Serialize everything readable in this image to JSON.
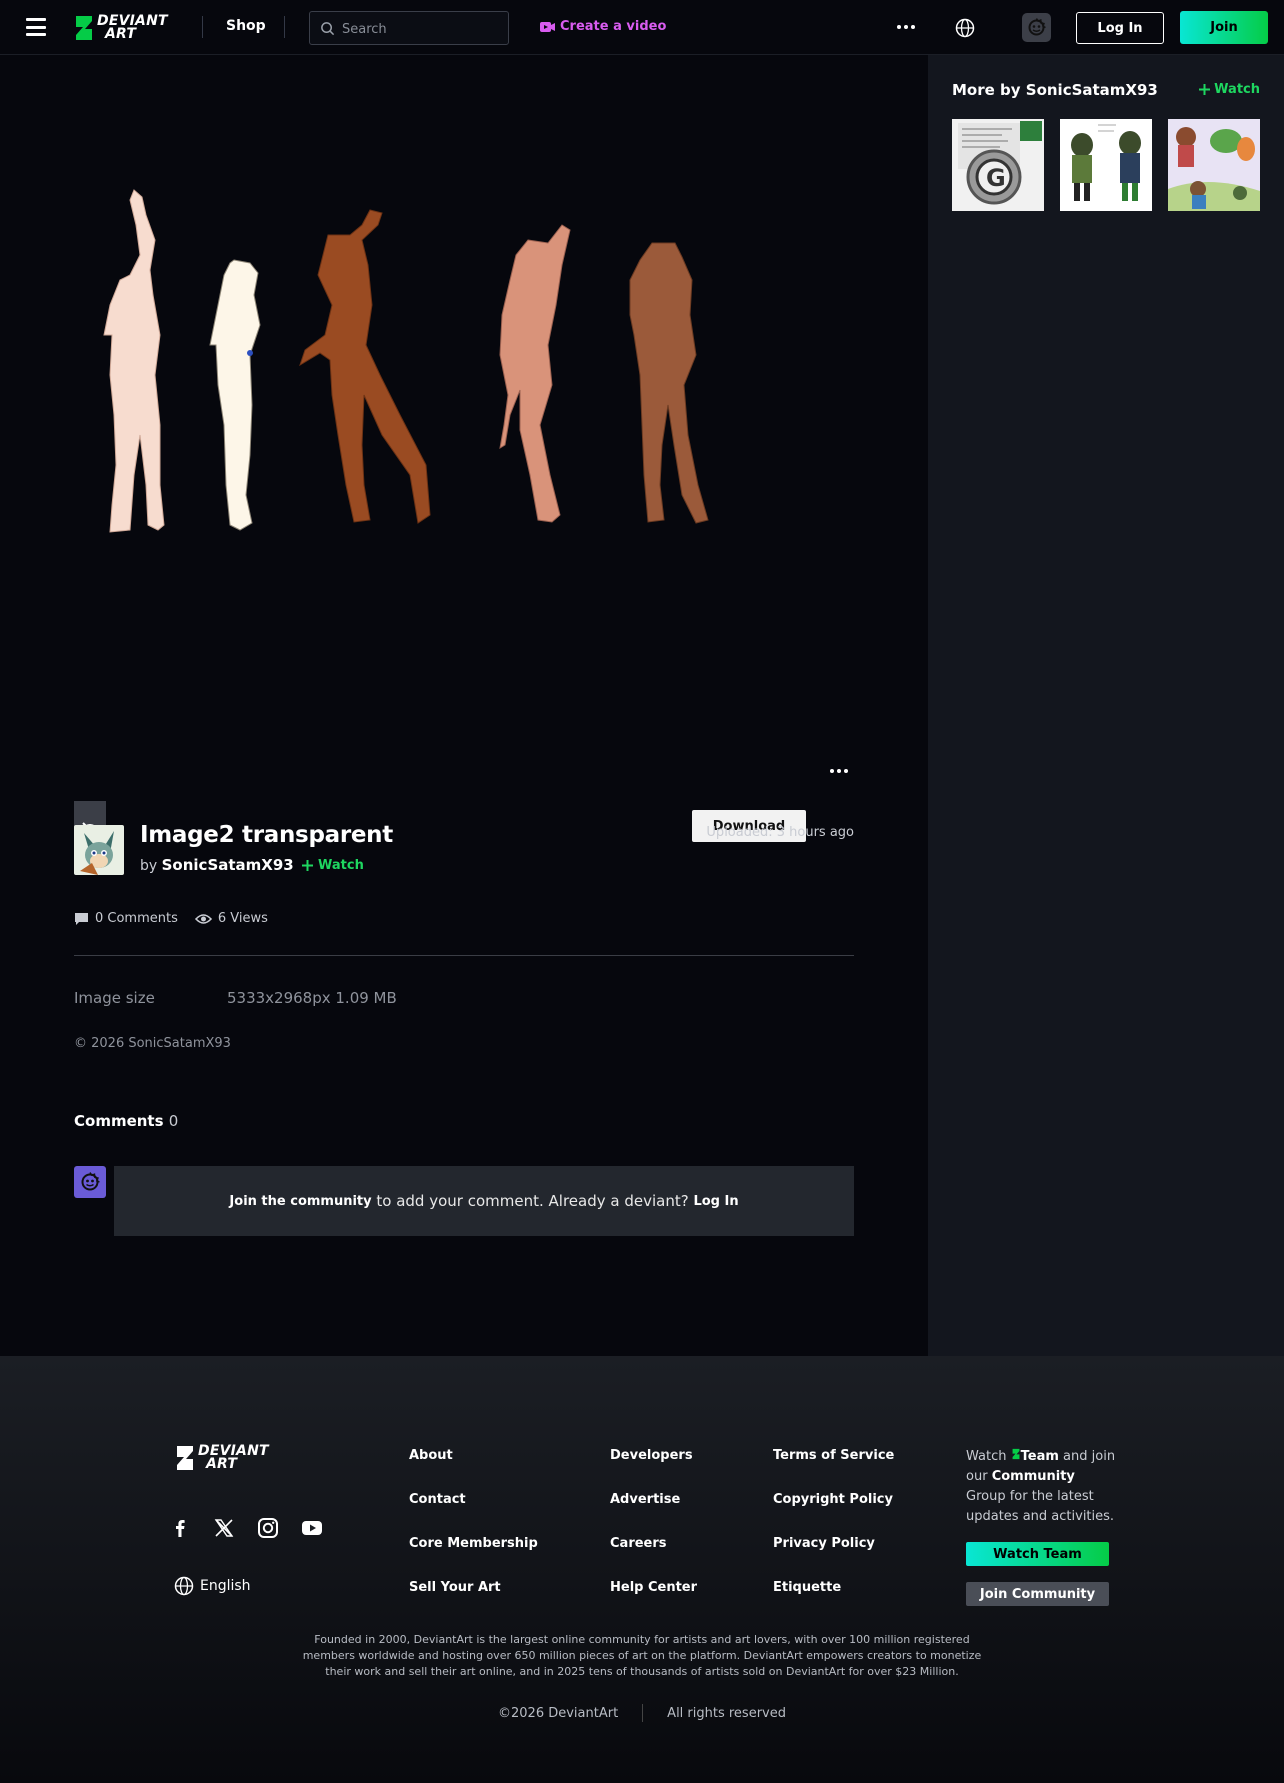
{
  "header": {
    "logo_line1": "DEVIANT",
    "logo_line2": "ART",
    "shop": "Shop",
    "search_placeholder": "Search",
    "create_video": "Create a video",
    "login": "Log In",
    "join": "Join",
    "accent_join": "#05cc47"
  },
  "sidebar": {
    "more_by": "More by SonicSatamX93",
    "watch": "Watch"
  },
  "deviation": {
    "download": "Download",
    "title": "Image2 transparent",
    "by": "by",
    "author": "SonicSatamX93",
    "watch": "Watch",
    "uploaded": "Uploaded: 3 hours ago",
    "comments_count": "0 Comments",
    "views_count": "6 Views",
    "image_size_label": "Image size",
    "image_size_value": "5333x2968px 1.09 MB",
    "copyright": "© 2026 SonicSatamX93"
  },
  "comments": {
    "title": "Comments",
    "count": "0",
    "join_link": "Join the community",
    "middle": " to add your comment. Already a deviant? ",
    "login_link": "Log In"
  },
  "footer": {
    "logo_line1": "DEVIANT",
    "logo_line2": "ART",
    "language": "English",
    "col1": [
      "About",
      "Contact",
      "Core Membership",
      "Sell Your Art"
    ],
    "col2": [
      "Developers",
      "Advertise",
      "Careers",
      "Help Center"
    ],
    "col3": [
      "Terms of Service",
      "Copyright Policy",
      "Privacy Policy",
      "Etiquette"
    ],
    "side_watch_word": "Watch",
    "side_team": "Team",
    "side_and": "and",
    "side_join_our": "join our",
    "side_community": "Community",
    "side_rest": "Group for the latest updates and activities.",
    "watch_team_btn": "Watch Team",
    "join_community_btn": "Join Community",
    "about_text": "Founded in 2000, DeviantArt is the largest online community for artists and art lovers, with over 100 million registered members worldwide and hosting over 650 million pieces of art on the platform. DeviantArt empowers creators to monetize their work and sell their art online, and in 2025 tens of thousands of artists sold on DeviantArt for over $23 Million.",
    "copyright": "©2026 DeviantArt",
    "rights": "All rights reserved"
  }
}
